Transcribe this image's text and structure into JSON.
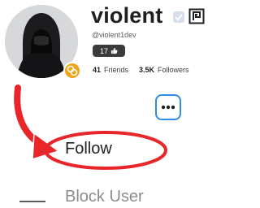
{
  "profile": {
    "display_name": "violent",
    "username": "@violent1dev",
    "level": "17",
    "friends_count": "41",
    "friends_label": "Friends",
    "followers_count": "3.5K",
    "followers_label": "Followers"
  },
  "menu": {
    "follow_label": "Follow",
    "block_label": "Block User"
  },
  "icons": {
    "verified": "verified-icon",
    "premium": "premium-icon",
    "level_thumb": "thumbs-up-icon",
    "more": "more-dots-icon",
    "avatar_badge": "premium-badge-icon"
  },
  "colors": {
    "accent_blue": "#2f8ce8",
    "annotation_red": "#e8262a",
    "premium_orange": "#f2a516"
  }
}
